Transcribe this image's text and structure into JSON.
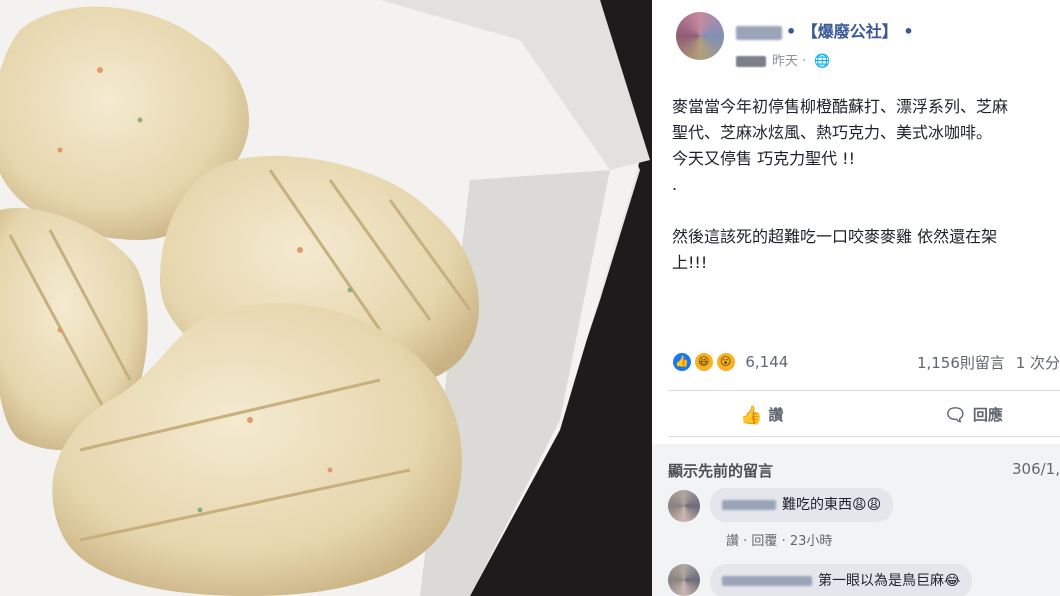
{
  "post": {
    "author_tail": "• 【爆廢公社】 •",
    "timestamp": "昨天 · ",
    "privacy_icon": "globe-icon",
    "text": "麥當當今年初停售柳橙酷蘇打、漂浮系列、芝麻\n聖代、芝麻冰炫風、熱巧克力、美式冰咖啡。\n今天又停售 巧克力聖代 !!\n.\n\n然後這該死的超難吃一口咬麥麥雞 依然還在架\n上!!!"
  },
  "reactions": {
    "icons": [
      "like-reaction-icon",
      "haha-reaction-icon",
      "wow-reaction-icon"
    ],
    "like_glyph": "👍",
    "haha_glyph": "😆",
    "wow_glyph": "😮",
    "count": "6,144",
    "comments_count": "1,156則留言",
    "shares": "1 次分"
  },
  "actions": {
    "like_label": "讚",
    "like_icon": "thumbs-up-icon",
    "comment_label": "回應",
    "comment_icon": "speech-bubble-icon"
  },
  "comments": {
    "view_previous": "顯示先前的留言",
    "count_shown": "306/1,",
    "items": [
      {
        "text": "難吃的東西😩😩",
        "like": "讚",
        "reply": "回覆",
        "time": "23小時"
      },
      {
        "text": "第一眼以為是鳥巨麻😂"
      }
    ]
  },
  "colors": {
    "link": "#3b5998",
    "like_blue": "#1877f2",
    "comment_bg": "#f2f3f5"
  }
}
